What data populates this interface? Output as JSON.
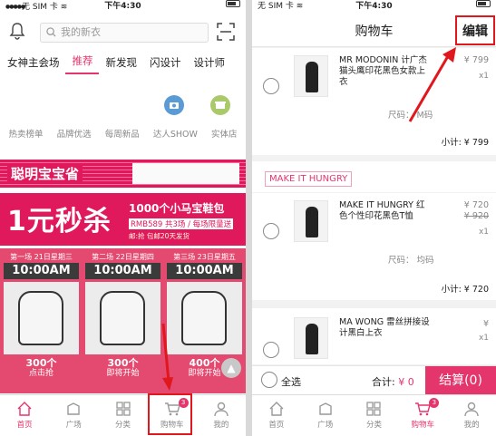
{
  "status_bar": {
    "carrier": "无 SIM 卡",
    "time": "下午4:30"
  },
  "left": {
    "search_placeholder": "我的新衣",
    "tabs": [
      "女神主会场",
      "推荐",
      "新发现",
      "闪设计",
      "设计师"
    ],
    "quick_links": [
      "热卖榜单",
      "品牌优选",
      "每周新品",
      "达人SHOW",
      "实体店"
    ],
    "banner_headline": "聪明宝宝省",
    "flash_sale": {
      "headline": "1元秒杀",
      "promo_line1": "1000个小马宝鞋包",
      "promo_line2": "RMB589 共3场 / 每场限量送",
      "promo_line3": "邮:抢 包邮20天发货"
    },
    "sale_columns": [
      {
        "header": "第一场 21日星期三",
        "time": "10:00AM",
        "count": "300个",
        "status": "点击抢"
      },
      {
        "header": "第二场 22日星期四",
        "time": "10:00AM",
        "count": "300个",
        "status": "即将开始"
      },
      {
        "header": "第三场 23日星期五",
        "time": "10:00AM",
        "count": "400个",
        "status": "即将开始"
      }
    ],
    "tabbar": [
      "首页",
      "广场",
      "分类",
      "购物车",
      "我的"
    ],
    "cart_badge": "3"
  },
  "right": {
    "title": "购物车",
    "edit_label": "编辑",
    "items": [
      {
        "name": "MR MODONIN 计广杰 猫头鹰印花黑色女款上衣",
        "price": "¥ 799",
        "qty": "x1",
        "size": "尺码： M码",
        "subtotal": "小计: ¥ 799"
      },
      {
        "name": "MAKE IT HUNGRY 红色个性印花黑色T恤",
        "price": "¥ 720",
        "orig_price": "¥ 920",
        "qty": "x1",
        "size": "尺码： 均码",
        "subtotal": "小计: ¥ 720"
      },
      {
        "name": "MA WONG 雷丝拼接设计黑白上衣",
        "price": "¥",
        "qty": "x1"
      }
    ],
    "shop_name": "MAKE IT HUNGRY",
    "select_all": "全选",
    "total_label": "合计:",
    "total_value": "¥ 0",
    "checkout": "结算(0)",
    "tabbar": [
      "首页",
      "广场",
      "分类",
      "购物车",
      "我的"
    ],
    "cart_badge": "3"
  },
  "colors": {
    "accent": "#e4366c",
    "annotation": "#e0171c"
  }
}
